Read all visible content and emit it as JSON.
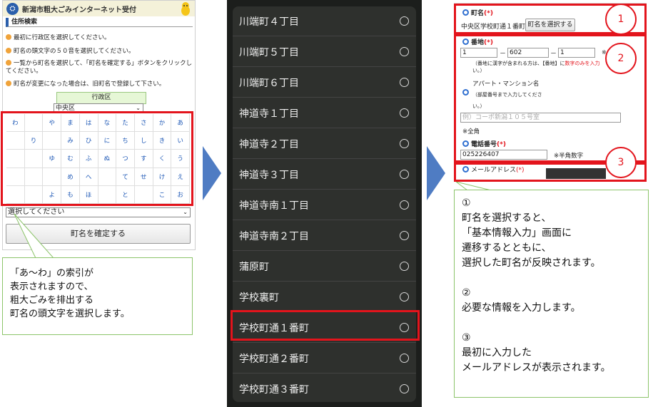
{
  "panel1": {
    "site_title": "新潟市粗大ごみインターネット受付",
    "section_title": "住所検索",
    "instructions": [
      "最初に行政区を選択してください。",
      "町名の頭文字の５０音を選択してください。",
      "一覧から町名を選択して、「町名を確定する」ボタンをクリックしてください。",
      "町名が変更になった場合は、旧町名で登録して下さい。"
    ],
    "ward_label": "行政区",
    "ward_value": "中央区",
    "kana_rows": [
      [
        "わ",
        "",
        "や",
        "ま",
        "は",
        "な",
        "た",
        "さ",
        "か",
        "あ"
      ],
      [
        "",
        "り",
        "",
        "み",
        "ひ",
        "に",
        "ち",
        "し",
        "き",
        "い"
      ],
      [
        "",
        "",
        "ゆ",
        "む",
        "ふ",
        "ぬ",
        "つ",
        "す",
        "く",
        "う"
      ],
      [
        "",
        "",
        "",
        "め",
        "へ",
        "",
        "て",
        "せ",
        "け",
        "え"
      ],
      [
        "",
        "",
        "よ",
        "も",
        "ほ",
        "",
        "と",
        "",
        "こ",
        "お"
      ]
    ],
    "town_select_placeholder": "選択してください",
    "confirm_button": "町名を確定する"
  },
  "callout1": {
    "lines": [
      "「あ～わ」の索引が",
      "表示されますので、",
      "粗大ごみを排出する",
      "町名の頭文字を選択します。"
    ]
  },
  "panel2": {
    "towns": [
      "川端町４丁目",
      "川端町５丁目",
      "川端町６丁目",
      "神道寺１丁目",
      "神道寺２丁目",
      "神道寺３丁目",
      "神道寺南１丁目",
      "神道寺南２丁目",
      "蒲原町",
      "学校裏町",
      "学校町通１番町",
      "学校町通２番町",
      "学校町通３番町"
    ],
    "selected_index": 10
  },
  "panel3": {
    "town_label": "町名",
    "required_mark": "(*)",
    "town_value": "中央区学校町通１番町",
    "select_town_button": "町名を選択する",
    "banchi_label": "番地",
    "banchi_values": [
      "1",
      "602",
      "1"
    ],
    "banchi_dash": "－",
    "banchi_note_mark": "※",
    "banchi_note_a": "（番地に漢字が含まれる方は、【番地】に",
    "banchi_note_red": "数字のみを入力",
    "banchi_note_b": "い。）",
    "apartment_label": "アパート・マンション名",
    "apartment_note_a": "（部屋番号まで入力してくださ",
    "apartment_note_b": "い。）",
    "apartment_placeholder": "例）コーポ新潟１０５号室",
    "zenkaku_note": "※全角",
    "phone_label": "電話番号",
    "phone_value": "025226407",
    "hankaku_note": "※半角数字",
    "email_label": "メールアドレス"
  },
  "markers": [
    "1",
    "2",
    "3"
  ],
  "callout2": {
    "lines": [
      "①",
      "町名を選択すると、",
      "「基本情報入力」画面に",
      "遷移するとともに、",
      "選択した町名が反映されます。",
      "",
      "②",
      "必要な情報を入力します。",
      "",
      "③",
      "最初に入力した",
      "メールアドレスが表示されます。"
    ]
  }
}
